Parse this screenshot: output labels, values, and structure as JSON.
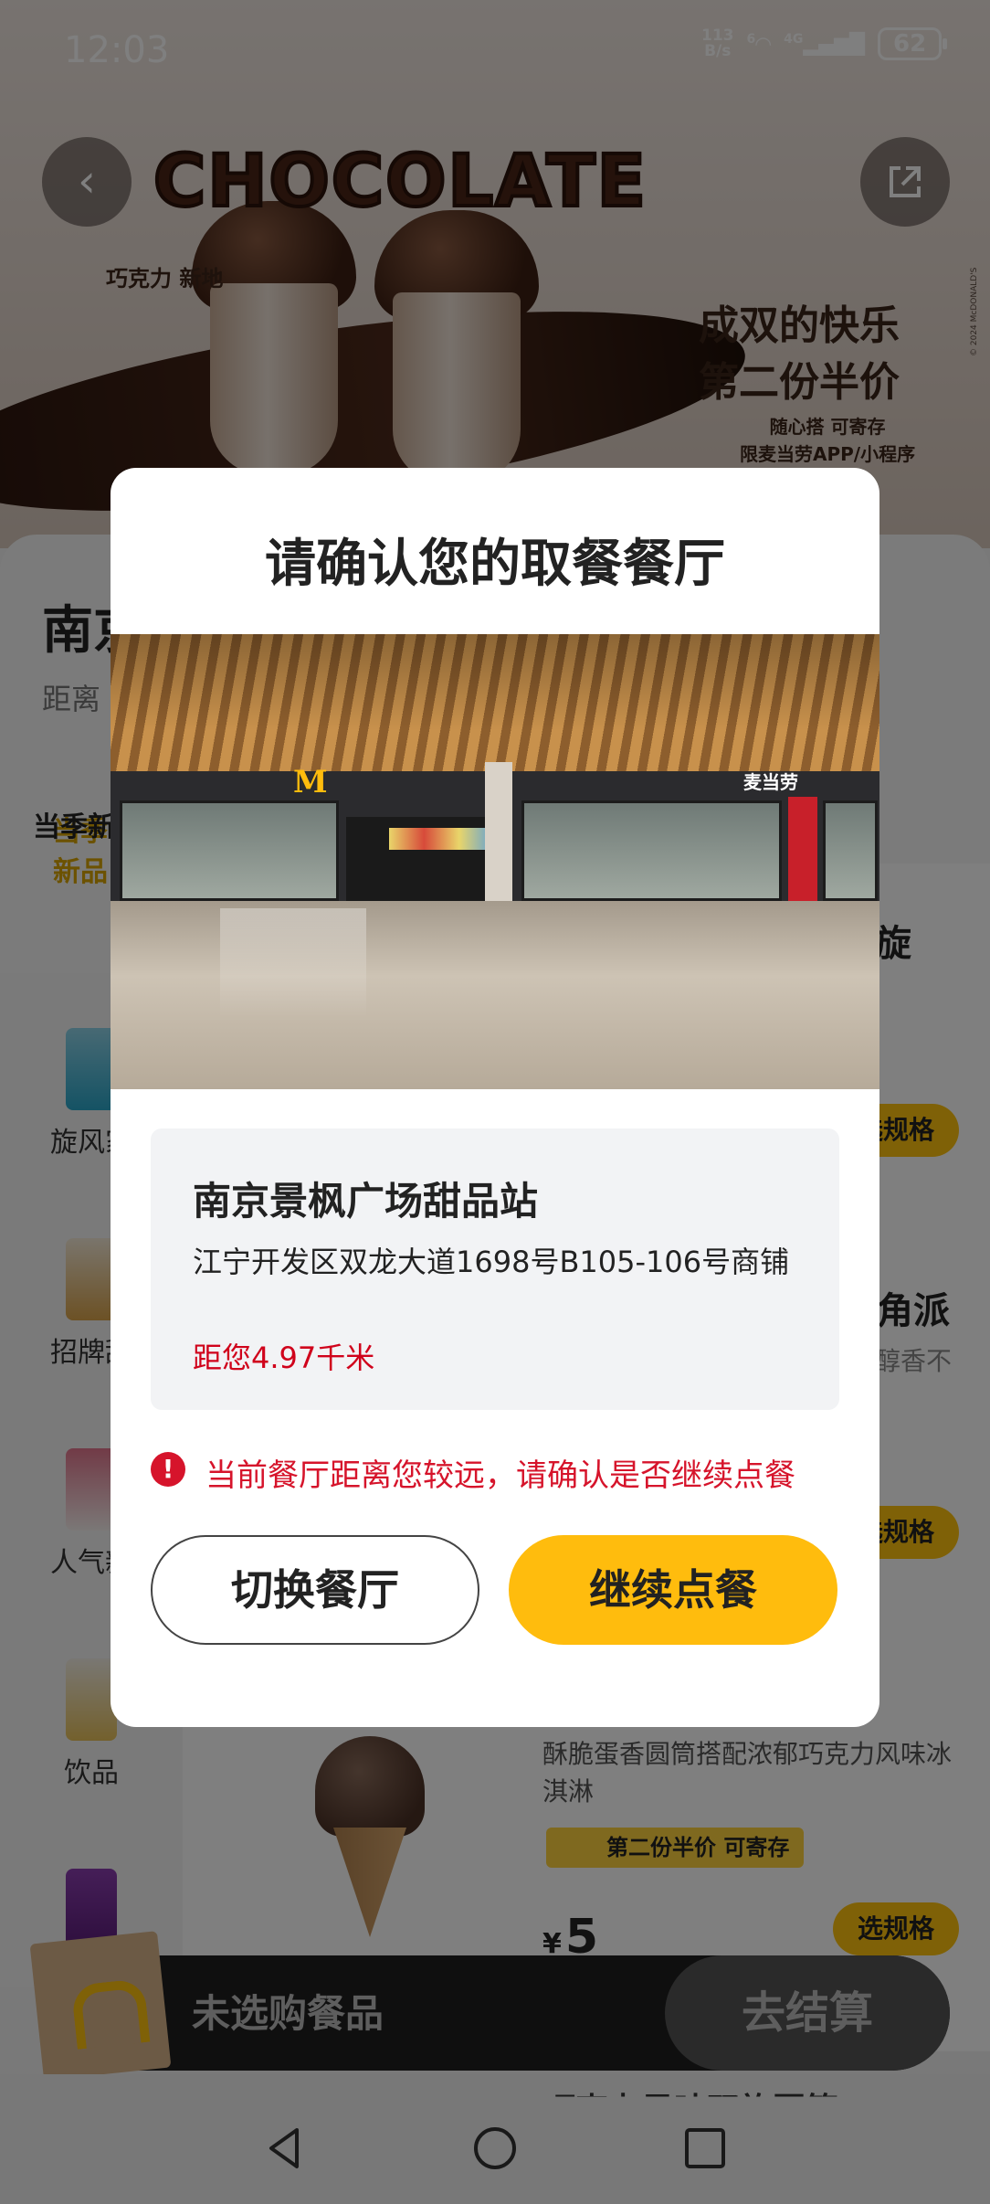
{
  "status_bar": {
    "time": "12:03",
    "net_speed_value": "113",
    "net_speed_unit": "B/s",
    "wifi_badge": "6",
    "network": "4G",
    "battery": "62"
  },
  "banner": {
    "title": "CHOCOLATE",
    "sub": "巧克力 新地",
    "headline_1": "成双的快乐",
    "headline_2": "第二份半价",
    "note_1": "随心搭 可寄存",
    "note_2": "限麦当劳APP/小程序",
    "copyright": "© 2024 McDONALD'S"
  },
  "store_background": {
    "name": "南京",
    "distance": "距离"
  },
  "sidebar": {
    "top_label": "当季新",
    "items": [
      {
        "label": "旋风家"
      },
      {
        "label": "招牌甜"
      },
      {
        "label": "人气新"
      },
      {
        "label": "饮品"
      }
    ]
  },
  "products_background": {
    "frag_1": "旋",
    "frag_2": "角派",
    "frag_3": "醇香不",
    "spec_label": "选规格",
    "desc": "酥脆蛋香圆筒搭配浓郁巧克力风味冰淇淋",
    "promo": "第二份半价 可寄存",
    "currency": "¥",
    "price": "5",
    "bottom_cut": "巧克力风味双旋圆筒"
  },
  "cart": {
    "empty_text": "未选购餐品",
    "checkout": "去结算"
  },
  "dialog": {
    "title": "请确认您的取餐餐厅",
    "photo_sign": "麦当劳",
    "store_name": "南京景枫广场甜品站",
    "address": "江宁开发区双龙大道1698号B105-106号商铺",
    "distance": "距您4.97千米",
    "warning": "当前餐厅距离您较远，请确认是否继续点餐",
    "switch_button": "切换餐厅",
    "continue_button": "继续点餐"
  },
  "colors": {
    "accent_yellow": "#ffbc0d",
    "warning_red": "#d6142b",
    "scrim": "rgba(0,0,0,0.5)"
  },
  "icons": [
    "back-arrow-icon",
    "share-icon",
    "warning-icon",
    "nav-back-icon",
    "nav-home-icon",
    "nav-recents-icon"
  ]
}
